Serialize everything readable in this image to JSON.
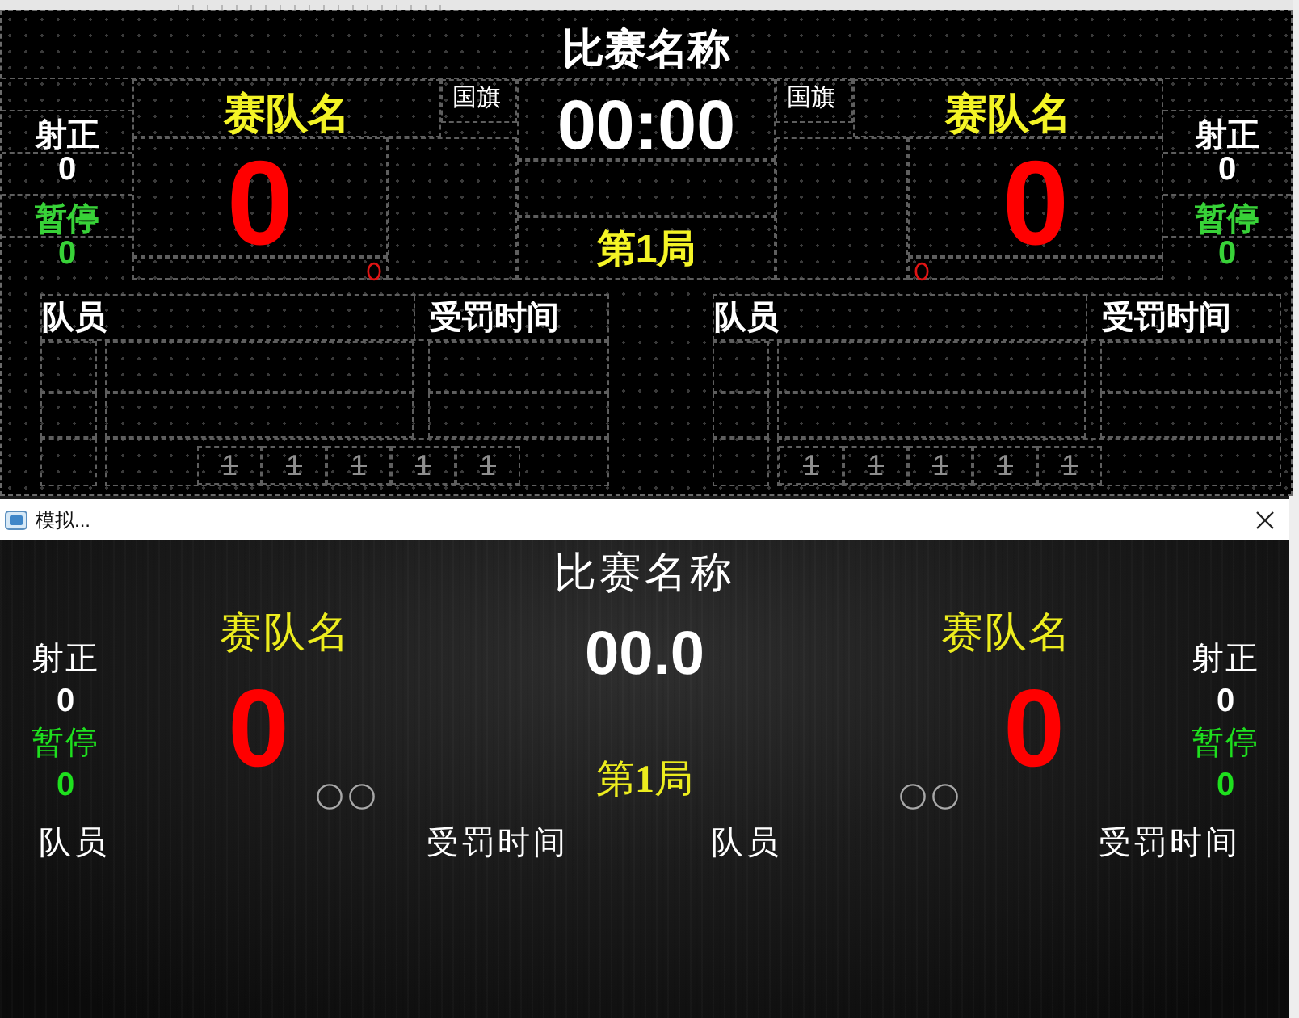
{
  "editor": {
    "title": "比赛名称",
    "clock": "00:00",
    "period": "第1局",
    "teams": [
      {
        "name": "赛队名",
        "flag": "国旗",
        "score": "0",
        "stats": [
          {
            "kind": "shots",
            "label": "射正",
            "value": "0"
          },
          {
            "kind": "timeouts",
            "label": "暂停",
            "value": "0"
          }
        ],
        "roster_header": "队员",
        "penalty_header": "受罚时间",
        "markers": [
          "1",
          "1",
          "1",
          "1",
          "1"
        ]
      },
      {
        "name": "赛队名",
        "flag": "国旗",
        "score": "0",
        "stats": [
          {
            "kind": "shots",
            "label": "射正",
            "value": "0"
          },
          {
            "kind": "timeouts",
            "label": "暂停",
            "value": "0"
          }
        ],
        "roster_header": "队员",
        "penalty_header": "受罚时间",
        "markers": [
          "1",
          "1",
          "1",
          "1",
          "1"
        ]
      }
    ]
  },
  "simulator": {
    "window_title": "模拟...",
    "title": "比赛名称",
    "clock": "00.0",
    "period": "第**1**局",
    "teams": [
      {
        "name": "赛队名",
        "score": "0",
        "stats": [
          {
            "kind": "shots",
            "label": "射正",
            "value": "0"
          },
          {
            "kind": "timeouts",
            "label": "暂停",
            "value": "0"
          }
        ],
        "indicators": [
          {
            "lit": false
          },
          {
            "lit": false
          }
        ],
        "roster_header": "队员",
        "penalty_header": "受罚时间"
      },
      {
        "name": "赛队名",
        "score": "0",
        "stats": [
          {
            "kind": "shots",
            "label": "射正",
            "value": "0"
          },
          {
            "kind": "timeouts",
            "label": "暂停",
            "value": "0"
          }
        ],
        "indicators": [
          {
            "lit": false
          },
          {
            "lit": false
          }
        ],
        "roster_header": "队员",
        "penalty_header": "受罚时间"
      }
    ]
  }
}
